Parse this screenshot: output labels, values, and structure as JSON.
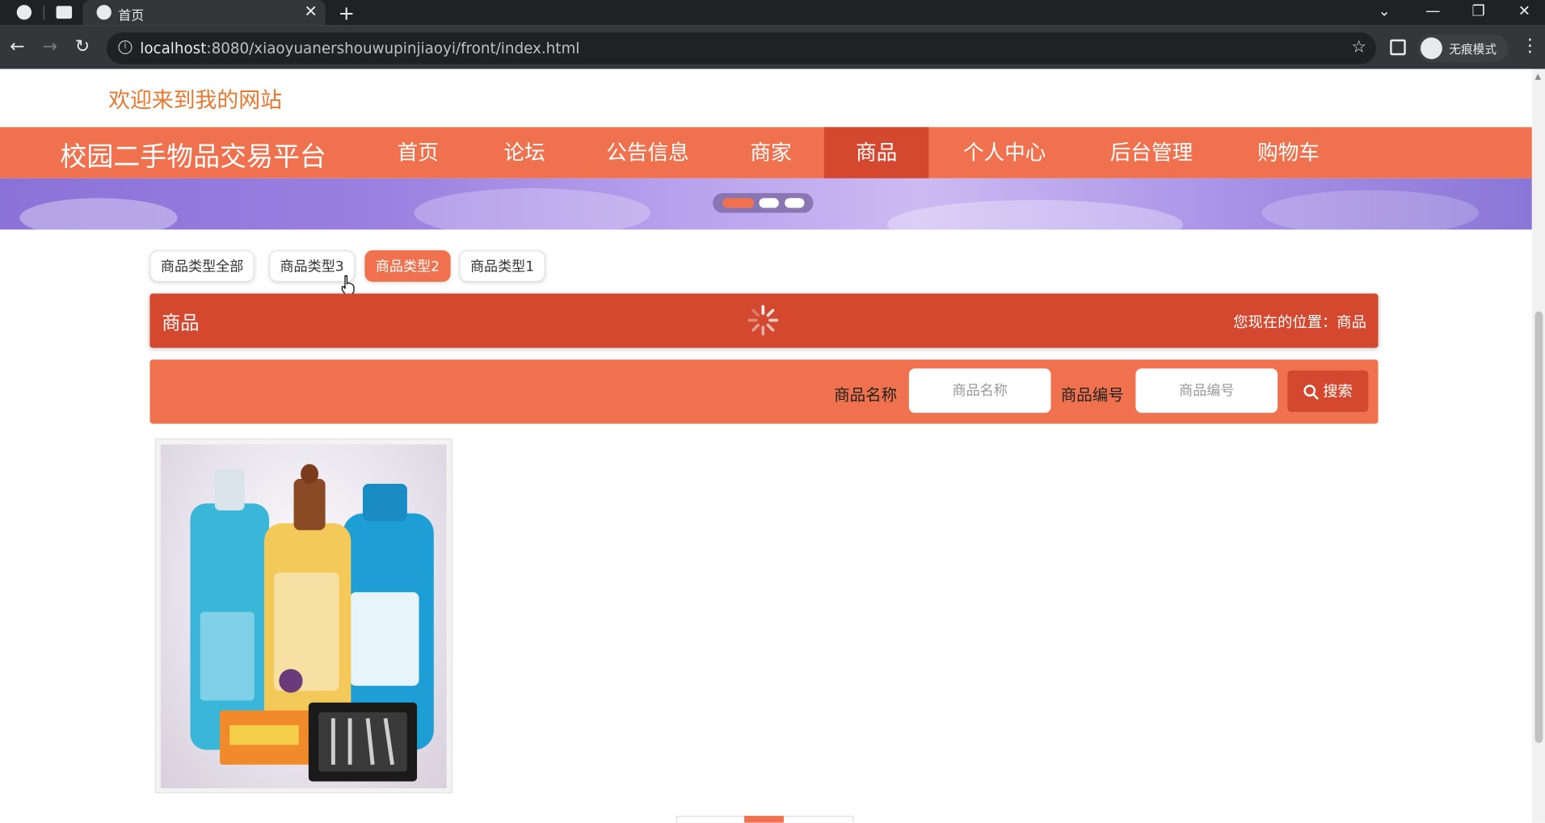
{
  "browser": {
    "tab_title": "首页",
    "url_host": "localhost",
    "url_rest": ":8080/xiaoyuanershouwupinjiaoyi/front/index.html",
    "incognito_label": "无痕模式"
  },
  "header": {
    "welcome": "欢迎来到我的网站"
  },
  "nav": {
    "brand": "校园二手物品交易平台",
    "items": [
      {
        "label": "首页"
      },
      {
        "label": "论坛"
      },
      {
        "label": "公告信息"
      },
      {
        "label": "商家"
      },
      {
        "label": "商品"
      },
      {
        "label": "个人中心"
      },
      {
        "label": "后台管理"
      },
      {
        "label": "购物车"
      }
    ],
    "active": "商品"
  },
  "carousel": {
    "slide_count": 3,
    "active_index": 0
  },
  "categories": [
    {
      "label": "商品类型全部"
    },
    {
      "label": "商品类型3"
    },
    {
      "label": "商品类型2"
    },
    {
      "label": "商品类型1"
    }
  ],
  "active_category": "商品类型2",
  "section": {
    "title": "商品",
    "location": "您现在的位置：商品"
  },
  "search": {
    "name_label": "商品名称",
    "name_placeholder": "商品名称",
    "code_label": "商品编号",
    "code_placeholder": "商品编号",
    "button": "搜索"
  },
  "colors": {
    "accent": "#ef714e",
    "accent_dark": "#d3482e",
    "welcome": "#e8772e"
  }
}
